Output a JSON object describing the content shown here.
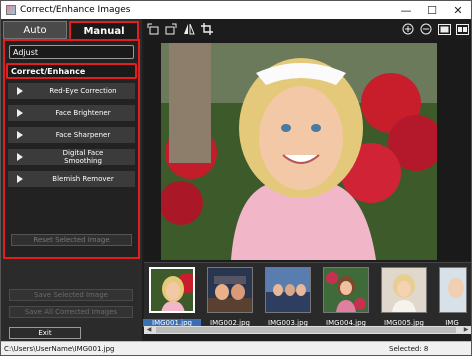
{
  "window": {
    "title": "Correct/Enhance Images"
  },
  "tabs": {
    "auto": "Auto",
    "manual": "Manual"
  },
  "sections": {
    "adjust": "Adjust",
    "correct": "Correct/Enhance"
  },
  "tools": [
    {
      "label": "Red-Eye Correction",
      "icon": "play-triangle-icon"
    },
    {
      "label": "Face Brightener",
      "icon": "play-triangle-icon"
    },
    {
      "label": "Face Sharpener",
      "icon": "play-triangle-icon"
    },
    {
      "label": "Digital Face Smoothing",
      "icon": "play-triangle-icon"
    },
    {
      "label": "Blemish Remover",
      "icon": "play-triangle-icon"
    }
  ],
  "buttons": {
    "reset": "Reset Selected Image",
    "save_selected": "Save Selected Image",
    "save_all": "Save All Corrected Images",
    "exit": "Exit"
  },
  "toolbar_icons": [
    "rotate-left-icon",
    "rotate-right-icon",
    "flip-icon",
    "crop-icon",
    "zoom-in-icon",
    "zoom-out-icon",
    "single-view-icon",
    "compare-view-icon"
  ],
  "thumbnails": [
    {
      "name": "IMG001.jpg",
      "selected": true
    },
    {
      "name": "IMG002.jpg",
      "selected": false
    },
    {
      "name": "IMG003.jpg",
      "selected": false
    },
    {
      "name": "IMG004.jpg",
      "selected": false
    },
    {
      "name": "IMG005.jpg",
      "selected": false
    },
    {
      "name": "IMG",
      "selected": false
    }
  ],
  "status": {
    "path": "C:\\Users\\UserName\\IMG001.jpg",
    "selected": "Selected: 8"
  },
  "colors": {
    "highlight": "#e02020",
    "selection": "#3a6fb0"
  }
}
